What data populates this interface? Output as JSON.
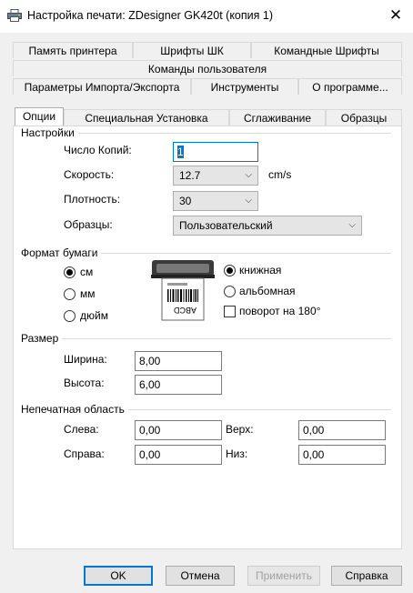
{
  "window": {
    "title": "Настройка печати: ZDesigner GK420t (копия 1)",
    "close_icon": "close-icon",
    "app_icon": "printer-icon"
  },
  "tabs": {
    "row1": [
      "Память принтера",
      "Шрифты ШК",
      "Командные Шрифты"
    ],
    "row2": [
      "Команды пользователя"
    ],
    "row3": [
      "Параметры Импорта/Экспорта",
      "Инструменты",
      "О программе..."
    ],
    "row4": [
      "Опции",
      "Специальная Установка",
      "Сглаживание",
      "Образцы"
    ],
    "active": "Опции"
  },
  "settings": {
    "group_title": "Настройки",
    "copies_label": "Число Копий:",
    "copies_value": "1",
    "speed_label": "Скорость:",
    "speed_value": "12.7",
    "speed_unit": "cm/s",
    "darkness_label": "Плотность:",
    "darkness_value": "30",
    "stocks_label": "Образцы:",
    "stocks_value": "Пользовательский"
  },
  "paper_format": {
    "group_title": "Формат бумаги",
    "units": [
      {
        "label": "см",
        "checked": true
      },
      {
        "label": "мм",
        "checked": false
      },
      {
        "label": "дюйм",
        "checked": false
      }
    ],
    "orientation": [
      {
        "label": "книжная",
        "checked": true
      },
      {
        "label": "альбомная",
        "checked": false
      }
    ],
    "rotate_label": "поворот на 180°",
    "rotate_checked": false,
    "label_preview_text": "ABCD"
  },
  "size": {
    "group_title": "Размер",
    "width_label": "Ширина:",
    "width_value": "8,00",
    "height_label": "Высота:",
    "height_value": "6,00"
  },
  "unprintable": {
    "group_title": "Непечатная область",
    "left_label": "Слева:",
    "left_value": "0,00",
    "top_label": "Верх:",
    "top_value": "0,00",
    "right_label": "Справа:",
    "right_value": "0,00",
    "bottom_label": "Низ:",
    "bottom_value": "0,00"
  },
  "buttons": {
    "ok": "OK",
    "cancel": "Отмена",
    "apply": "Применить",
    "help": "Справка"
  }
}
